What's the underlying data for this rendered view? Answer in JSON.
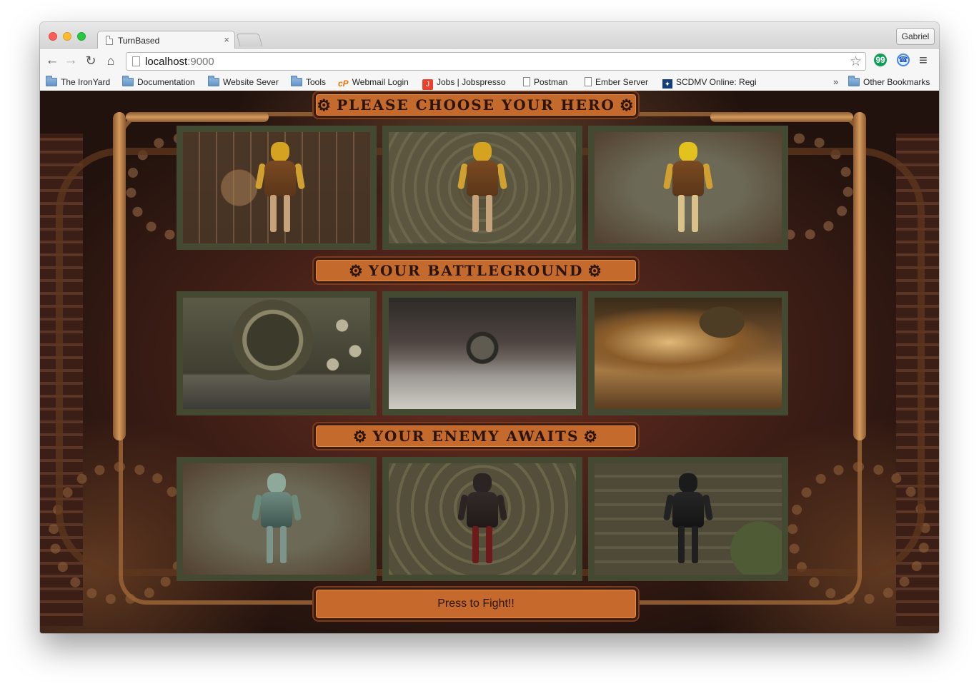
{
  "browser": {
    "tab_title": "TurnBased",
    "tab_close": "×",
    "profile_name": "Gabriel",
    "url_host": "localhost",
    "url_port": ":9000",
    "nav": {
      "back": "←",
      "forward": "→",
      "reload": "↻",
      "home": "⌂",
      "star": "☆",
      "menu": "≡"
    },
    "extensions": [
      {
        "icon": "hangouts-icon",
        "glyph": "99"
      },
      {
        "icon": "phone-icon",
        "glyph": "☎"
      }
    ]
  },
  "bookmarks": {
    "items": [
      {
        "label": "The IronYard",
        "icon": "folder-icon"
      },
      {
        "label": "Documentation",
        "icon": "folder-icon"
      },
      {
        "label": "Website Sever",
        "icon": "folder-icon"
      },
      {
        "label": "Tools",
        "icon": "folder-icon"
      },
      {
        "label": "Webmail Login",
        "icon": "cpanel-icon",
        "glyph": "cP"
      },
      {
        "label": "Jobs | Jobspresso",
        "icon": "jobspresso-icon",
        "glyph": "J"
      },
      {
        "label": "Postman",
        "icon": "page-icon"
      },
      {
        "label": "Ember Server",
        "icon": "page-icon"
      },
      {
        "label": "SCDMV Online: Regi",
        "icon": "scdmv-icon",
        "glyph": "✦"
      }
    ],
    "overflow": "»",
    "other": "Other Bookmarks"
  },
  "game": {
    "cog_glyph": "⚙",
    "sections": [
      {
        "title": "PLEASE CHOOSE YOUR HERO",
        "cards": [
          "hero-card",
          "hero-card",
          "hero-card"
        ]
      },
      {
        "title": "YOUR BATTLEGROUND",
        "cards": [
          "battleground-card",
          "battleground-card",
          "battleground-card"
        ]
      },
      {
        "title": "YOUR ENEMY AWAITS",
        "cards": [
          "enemy-card",
          "enemy-card",
          "enemy-card"
        ]
      }
    ],
    "fight_button": "Press to Fight!!"
  }
}
